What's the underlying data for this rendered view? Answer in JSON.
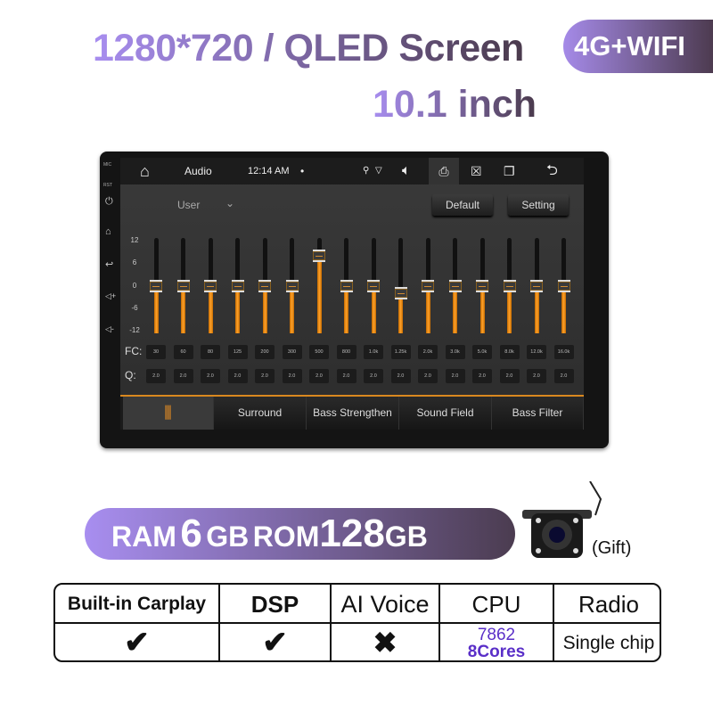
{
  "header": {
    "title": "1280*720 / QLED Screen",
    "size": "10.1 inch",
    "badge": "4G+WIFI"
  },
  "device": {
    "side_labels": {
      "mic": "MIC",
      "rst": "RST"
    },
    "side_icons": [
      "power-icon",
      "home-icon",
      "back-icon",
      "volume-up-icon",
      "volume-down-icon"
    ],
    "status_bar": {
      "app": "Audio",
      "time": "12:14 AM",
      "dot": "•",
      "icons": [
        "home-icon",
        "location-icon",
        "wifi-icon",
        "volume-icon",
        "screenshot-icon",
        "close-window-icon",
        "recent-apps-icon",
        "back-icon"
      ]
    },
    "preset": "User",
    "buttons": {
      "default": "Default",
      "setting": "Setting"
    },
    "eq": {
      "scale_ticks": [
        "12",
        "6",
        "0",
        "-6",
        "-12"
      ],
      "range": [
        -12,
        12
      ],
      "fc_label": "FC:",
      "q_label": "Q:",
      "bands": [
        {
          "fc": "30",
          "q": "2.0",
          "gain": 0
        },
        {
          "fc": "60",
          "q": "2.0",
          "gain": 0
        },
        {
          "fc": "80",
          "q": "2.0",
          "gain": 0
        },
        {
          "fc": "125",
          "q": "2.0",
          "gain": 0
        },
        {
          "fc": "200",
          "q": "2.0",
          "gain": 0
        },
        {
          "fc": "300",
          "q": "2.0",
          "gain": 0
        },
        {
          "fc": "500",
          "q": "2.0",
          "gain": 8
        },
        {
          "fc": "800",
          "q": "2.0",
          "gain": 0
        },
        {
          "fc": "1.0k",
          "q": "2.0",
          "gain": 0
        },
        {
          "fc": "1.25k",
          "q": "2.0",
          "gain": -2
        },
        {
          "fc": "2.0k",
          "q": "2.0",
          "gain": 0
        },
        {
          "fc": "3.0k",
          "q": "2.0",
          "gain": 0
        },
        {
          "fc": "5.0k",
          "q": "2.0",
          "gain": 0
        },
        {
          "fc": "8.0k",
          "q": "2.0",
          "gain": 0
        },
        {
          "fc": "12.0k",
          "q": "2.0",
          "gain": 0
        },
        {
          "fc": "16.0k",
          "q": "2.0",
          "gain": 0
        }
      ],
      "accent": "#ff9a1f"
    },
    "tabs": [
      {
        "icon": "equalizer-icon",
        "label": ""
      },
      {
        "label": "Surround"
      },
      {
        "label": "Bass Strengthen"
      },
      {
        "label": "Sound Field"
      },
      {
        "label": "Bass Filter"
      }
    ]
  },
  "memory": {
    "ram_label": "RAM",
    "ram_value": "6",
    "ram_unit": "GB",
    "rom_label": "ROM",
    "rom_value": "128",
    "rom_unit": "GB"
  },
  "gift": "(Gift)",
  "specs": {
    "headers": [
      "Built-in Carplay",
      "DSP",
      "AI Voice",
      "CPU",
      "Radio"
    ],
    "values": {
      "carplay": "check",
      "dsp": "check",
      "ai_voice": "cross",
      "cpu_model": "7862",
      "cpu_cores": "8Cores",
      "radio": "Single chip"
    },
    "cpu_color": "#5a2fc8"
  }
}
